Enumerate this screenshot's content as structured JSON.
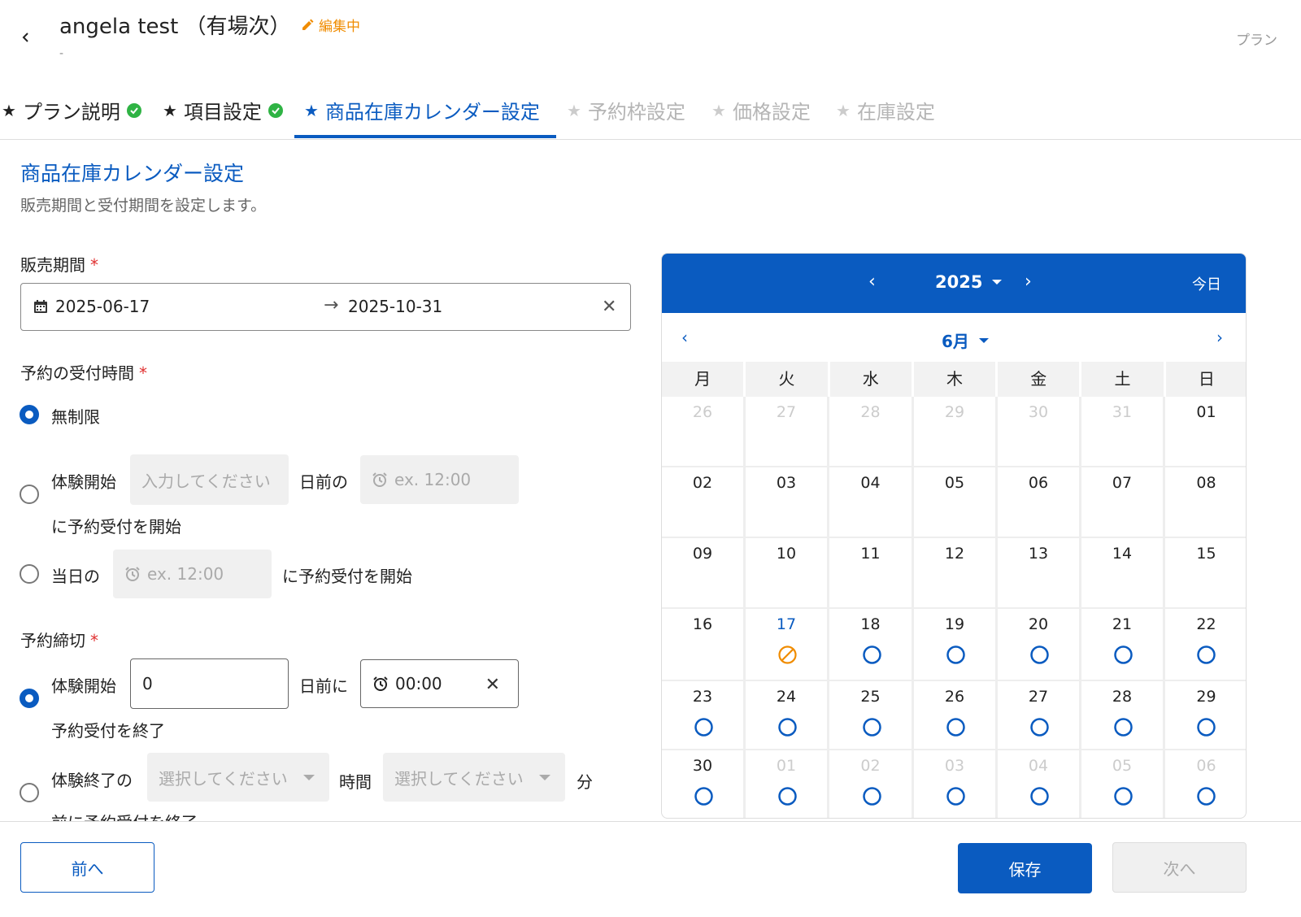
{
  "header": {
    "title": "angela test （有場次）",
    "editing_label": "編集中",
    "sub": "-",
    "top_right": "プラン"
  },
  "tabs": [
    {
      "label": "プラン説明",
      "state": "done"
    },
    {
      "label": "項目設定",
      "state": "done"
    },
    {
      "label": "商品在庫カレンダー設定",
      "state": "active"
    },
    {
      "label": "予約枠設定",
      "state": "disabled"
    },
    {
      "label": "価格設定",
      "state": "disabled"
    },
    {
      "label": "在庫設定",
      "state": "disabled"
    }
  ],
  "section": {
    "title": "商品在庫カレンダー設定",
    "desc": "販売期間と受付期間を設定します。"
  },
  "sales_period": {
    "label": "販売期間",
    "required_mark": "*",
    "start": "2025-06-17",
    "arrow": "→",
    "end": "2025-10-31",
    "clear": "✕"
  },
  "reception": {
    "label": "予約の受付時間",
    "required_mark": "*",
    "opt1": "無制限",
    "opt2_prefix": "体験開始",
    "opt2_days_placeholder": "入力してください",
    "opt2_mid": "日前の",
    "opt2_time_placeholder": "ex. 12:00",
    "opt2_suffix": "に予約受付を開始",
    "opt3_prefix": "当日の",
    "opt3_time_placeholder": "ex. 12:00",
    "opt3_suffix": "に予約受付を開始"
  },
  "deadline": {
    "label": "予約締切",
    "required_mark": "*",
    "opt1_prefix": "体験開始",
    "opt1_days": "0",
    "opt1_mid": "日前に",
    "opt1_time": "00:00",
    "opt1_clear": "✕",
    "opt1_suffix": "予約受付を終了",
    "opt2_prefix": "体験終了の",
    "opt2_hour_placeholder": "選択してください",
    "opt2_mid": "時間",
    "opt2_min_placeholder": "選択してください",
    "opt2_unit": "分",
    "opt2_suffix": "前に予約受付を終了"
  },
  "calendar": {
    "year": "2025",
    "month": "6月",
    "today": "今日",
    "weekdays": [
      "月",
      "火",
      "水",
      "木",
      "金",
      "土",
      "日"
    ],
    "accent": "#0a5bc0",
    "unavailable_color": "#f08c00",
    "weeks": [
      [
        {
          "d": "26",
          "o": 1
        },
        {
          "d": "27",
          "o": 1
        },
        {
          "d": "28",
          "o": 1
        },
        {
          "d": "29",
          "o": 1
        },
        {
          "d": "30",
          "o": 1
        },
        {
          "d": "31",
          "o": 1
        },
        {
          "d": "01"
        }
      ],
      [
        {
          "d": "02"
        },
        {
          "d": "03"
        },
        {
          "d": "04"
        },
        {
          "d": "05"
        },
        {
          "d": "06"
        },
        {
          "d": "07"
        },
        {
          "d": "08"
        }
      ],
      [
        {
          "d": "09"
        },
        {
          "d": "10"
        },
        {
          "d": "11"
        },
        {
          "d": "12"
        },
        {
          "d": "13"
        },
        {
          "d": "14"
        },
        {
          "d": "15"
        }
      ],
      [
        {
          "d": "16"
        },
        {
          "d": "17",
          "cur": 1,
          "m": "x"
        },
        {
          "d": "18",
          "m": "o"
        },
        {
          "d": "19",
          "m": "o"
        },
        {
          "d": "20",
          "m": "o"
        },
        {
          "d": "21",
          "m": "o"
        },
        {
          "d": "22",
          "m": "o"
        }
      ],
      [
        {
          "d": "23",
          "m": "o"
        },
        {
          "d": "24",
          "m": "o"
        },
        {
          "d": "25",
          "m": "o"
        },
        {
          "d": "26",
          "m": "o"
        },
        {
          "d": "27",
          "m": "o"
        },
        {
          "d": "28",
          "m": "o"
        },
        {
          "d": "29",
          "m": "o"
        }
      ],
      [
        {
          "d": "30",
          "m": "o"
        },
        {
          "d": "01",
          "o": 1,
          "m": "o"
        },
        {
          "d": "02",
          "o": 1,
          "m": "o"
        },
        {
          "d": "03",
          "o": 1,
          "m": "o"
        },
        {
          "d": "04",
          "o": 1,
          "m": "o"
        },
        {
          "d": "05",
          "o": 1,
          "m": "o"
        },
        {
          "d": "06",
          "o": 1,
          "m": "o"
        }
      ]
    ]
  },
  "footer": {
    "prev": "前へ",
    "save": "保存",
    "next": "次へ"
  }
}
